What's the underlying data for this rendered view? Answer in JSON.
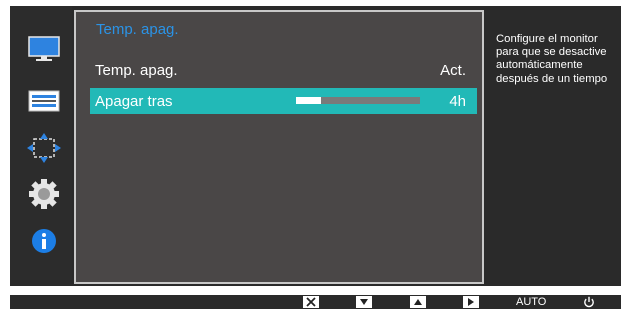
{
  "menu": {
    "title": "Temp. apag.",
    "rows": [
      {
        "label": "Temp. apag.",
        "value": "Act."
      },
      {
        "label": "Apagar tras",
        "value": "4h",
        "slider_level": 0.2
      }
    ]
  },
  "help": {
    "text": "Configure el monitor\npara que se desactive\nautomáticamente\ndespués de un tiempo"
  },
  "sidebar": {
    "icons": [
      "picture-icon",
      "onscreen-display-icon",
      "position-size-icon",
      "settings-gear-icon",
      "information-icon"
    ]
  },
  "bottom_keys": {
    "close": "close-key-icon",
    "down": "down-arrow-key-icon",
    "up": "up-arrow-key-icon",
    "enter": "right-arrow-key-icon",
    "auto_label": "AUTO",
    "power": "power-icon"
  },
  "colors": {
    "accent_teal": "#22b9b7",
    "title_blue": "#2b93e6",
    "panel_bg": "#4a4747",
    "osd_bg": "#2a2a2a"
  }
}
